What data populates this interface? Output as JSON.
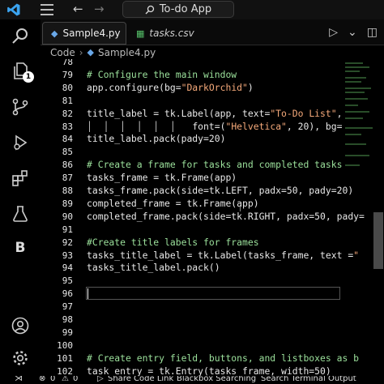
{
  "titlebar": {
    "search_text": "To-do App"
  },
  "activity": {
    "explorer_badge": "1",
    "extension_letter": "B"
  },
  "tabs": [
    {
      "label": "Sample4.py",
      "modified": true
    },
    {
      "label": "tasks.csv"
    }
  ],
  "breadcrumb": {
    "folder": "Code",
    "file": "Sample4.py"
  },
  "editor": {
    "lines": [
      {
        "n": "78",
        "parts": []
      },
      {
        "n": "79",
        "parts": [
          [
            "c",
            "# Configure the main window"
          ]
        ]
      },
      {
        "n": "80",
        "parts": [
          [
            "k",
            "app.configure(bg="
          ],
          [
            "s",
            "\"DarkOrchid\""
          ],
          [
            "k",
            ")"
          ]
        ]
      },
      {
        "n": "81",
        "parts": []
      },
      {
        "n": "82",
        "parts": [
          [
            "k",
            "title_label = tk.Label(app, text="
          ],
          [
            "s",
            "\"To-Do List\""
          ],
          [
            "k",
            ","
          ]
        ]
      },
      {
        "n": "83",
        "parts": [
          [
            "g",
            "│  │  │  │  │  │   "
          ],
          [
            "k",
            "font=("
          ],
          [
            "s",
            "\"Helvetica\""
          ],
          [
            "k",
            ", 20), bg="
          ]
        ]
      },
      {
        "n": "84",
        "parts": [
          [
            "k",
            "title_label.pack(pady=20)"
          ]
        ]
      },
      {
        "n": "85",
        "parts": []
      },
      {
        "n": "86",
        "parts": [
          [
            "c",
            "# Create a frame for tasks and completed tasks"
          ]
        ]
      },
      {
        "n": "87",
        "parts": [
          [
            "k",
            "tasks_frame = tk.Frame(app)"
          ]
        ]
      },
      {
        "n": "88",
        "parts": [
          [
            "k",
            "tasks_frame.pack(side=tk.LEFT, padx=50, pady=20)"
          ]
        ]
      },
      {
        "n": "89",
        "parts": [
          [
            "k",
            "completed_frame = tk.Frame(app)"
          ]
        ]
      },
      {
        "n": "90",
        "parts": [
          [
            "k",
            "completed_frame.pack(side=tk.RIGHT, padx=50, pady="
          ]
        ]
      },
      {
        "n": "91",
        "parts": []
      },
      {
        "n": "92",
        "parts": [
          [
            "c",
            "#Create title labels for frames"
          ]
        ]
      },
      {
        "n": "93",
        "parts": [
          [
            "k",
            "tasks_title_label = tk.Label(tasks_frame, text ="
          ],
          [
            "s",
            "\""
          ]
        ]
      },
      {
        "n": "94",
        "parts": [
          [
            "k",
            "tasks_title_label.pack()"
          ]
        ]
      },
      {
        "n": "95",
        "parts": []
      },
      {
        "n": "96",
        "parts": []
      },
      {
        "n": "97",
        "parts": []
      },
      {
        "n": "98",
        "parts": []
      },
      {
        "n": "99",
        "parts": []
      },
      {
        "n": "100",
        "parts": []
      },
      {
        "n": "101",
        "parts": [
          [
            "c",
            "# Create entry field, buttons, and listboxes as b"
          ]
        ]
      },
      {
        "n": "102",
        "parts": [
          [
            "k",
            "task_entry = tk.Entry(tasks_frame, width=50)"
          ]
        ]
      },
      {
        "n": "103",
        "parts": [
          [
            "k",
            "task_entry.pack(pady=10)"
          ]
        ]
      }
    ],
    "current_line": "96",
    "selected_line": "103"
  },
  "statusbar": {
    "errors": "0",
    "warnings": "0",
    "items": [
      "Share Code Link",
      "Blackbox Searching",
      "Search Terminal Output"
    ]
  }
}
